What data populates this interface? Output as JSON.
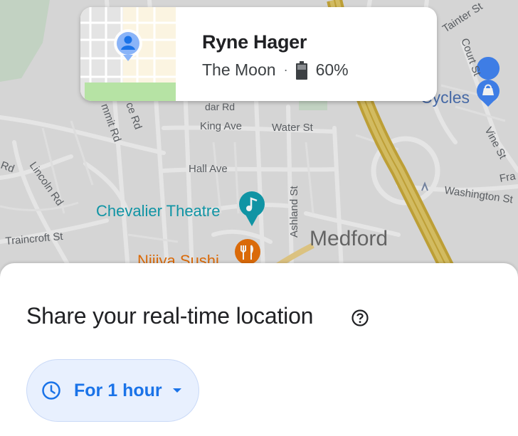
{
  "contact": {
    "name": "Ryne Hager",
    "location": "The Moon",
    "separator": "·",
    "battery": "60%"
  },
  "sheet": {
    "title": "Share your real-time location",
    "duration": "For 1 hour"
  },
  "map_labels": {
    "tainter": "Tainter St",
    "court": "Court St",
    "cycles": "Cycles",
    "vine": "Vine St",
    "fra": "Fra",
    "washington": "Washington St",
    "cedar": "dar Rd",
    "king": "King Ave",
    "water": "Water St",
    "summit": "mmit Rd",
    "ce_rd": "ce Rd",
    "hall": "Hall Ave",
    "rd_left": "Rd",
    "lincoln": "Lincoln Rd",
    "chevalier": "Chevalier Theatre",
    "ashland": "Ashland St",
    "medford": "Medford",
    "traincroft": "Traincroft St",
    "niiiya": "Niiiya Sushi"
  },
  "colors": {
    "accent": "#1a73e8",
    "chip_bg": "#e8f0fe",
    "highway": "#d4b64a",
    "poi_teal": "#129eaf",
    "poi_orange": "#e8710a",
    "poi_blue": "#4285f4"
  }
}
